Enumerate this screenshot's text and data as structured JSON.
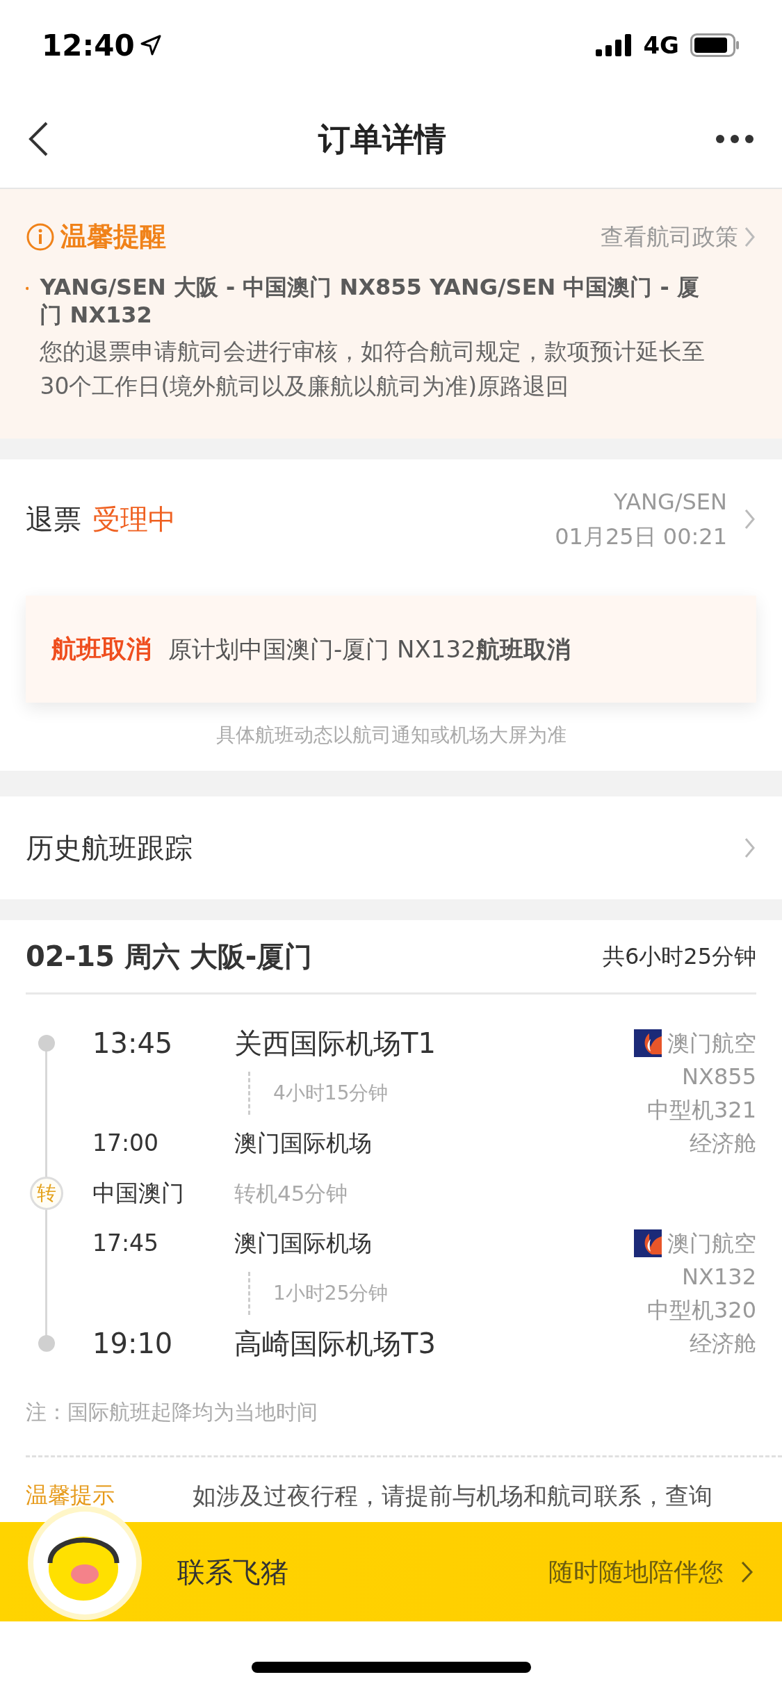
{
  "status_bar": {
    "time": "12:40",
    "network": "4G"
  },
  "nav": {
    "title": "订单详情"
  },
  "notice": {
    "title": "温馨提醒",
    "link": "查看航司政策",
    "items": [
      {
        "heading": "YANG/SEN 大阪 - 中国澳门 NX855 YANG/SEN 中国澳门 - 厦门 NX132",
        "body": "您的退票申请航司会进行审核，如符合航司规定，款项预计延长至30个工作日(境外航司以及廉航以航司为准)原路退回"
      }
    ]
  },
  "refund": {
    "label": "退票",
    "status": "受理中",
    "passenger": "YANG/SEN",
    "time": "01月25日 00:21",
    "alert": {
      "tag": "航班取消",
      "message": "原计划中国澳门-厦门 NX132**航班取消**"
    },
    "footnote": "具体航班动态以航司通知或机场大屏为准"
  },
  "history": {
    "label": "历史航班跟踪"
  },
  "trip": {
    "title": "02-15 周六 大阪-厦门",
    "total": "共6小时25分钟",
    "segments": [
      {
        "dep_time": "13:45",
        "dep_airport": "关西国际机场T1",
        "duration": "4小时15分钟",
        "arr_time": "17:00",
        "arr_airport": "澳门国际机场",
        "airline": "澳门航空",
        "flight": "NX855",
        "aircraft": "中型机321",
        "cabin": "经济舱"
      },
      {
        "dep_time": "17:45",
        "dep_airport": "澳门国际机场",
        "duration": "1小时25分钟",
        "arr_time": "19:10",
        "arr_airport": "高崎国际机场T3",
        "airline": "澳门航空",
        "flight": "NX132",
        "aircraft": "中型机320",
        "cabin": "经济舱"
      }
    ],
    "transfers": [
      {
        "badge": "转",
        "city": "中国澳门",
        "wait": "转机45分钟"
      }
    ],
    "note": "注：国际航班起降均为当地时间",
    "tip": {
      "label": "温馨提示",
      "text": "如涉及过夜行程，请提前与机场和航司联系，查询"
    }
  },
  "contact": {
    "label": "联系飞猪",
    "slogan": "随时随地陪伴您"
  }
}
